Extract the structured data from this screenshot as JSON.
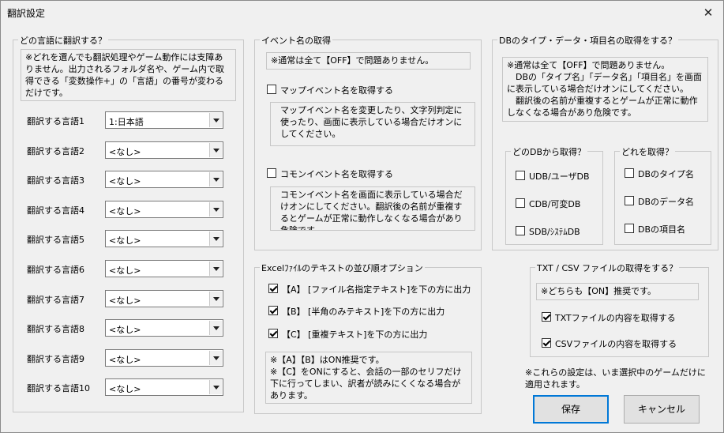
{
  "window": {
    "title": "翻訳設定",
    "close": "✕"
  },
  "lang_group": {
    "title": "どの言語に翻訳する？",
    "note": "※どれを選んでも翻訳処理やゲーム動作には支障ありません。出力されるフォルダ名や、ゲーム内で取得できる「変数操作+」の「言語」の番号が変わるだけです。",
    "rows": [
      {
        "label": "翻訳する言語1",
        "value": "1:日本語"
      },
      {
        "label": "翻訳する言語2",
        "value": "<なし>"
      },
      {
        "label": "翻訳する言語3",
        "value": "<なし>"
      },
      {
        "label": "翻訳する言語4",
        "value": "<なし>"
      },
      {
        "label": "翻訳する言語5",
        "value": "<なし>"
      },
      {
        "label": "翻訳する言語6",
        "value": "<なし>"
      },
      {
        "label": "翻訳する言語7",
        "value": "<なし>"
      },
      {
        "label": "翻訳する言語8",
        "value": "<なし>"
      },
      {
        "label": "翻訳する言語9",
        "value": "<なし>"
      },
      {
        "label": "翻訳する言語10",
        "value": "<なし>"
      }
    ]
  },
  "event_group": {
    "title": "イベント名の取得",
    "note": "※通常は全て【OFF】で問題ありません。",
    "map": {
      "label": "マップイベント名を取得する",
      "checked": false,
      "note": "マップイベント名を変更したり、文字列判定に使ったり、画面に表示している場合だけオンにしてください。"
    },
    "common": {
      "label": "コモンイベント名を取得する",
      "checked": false,
      "note": "コモンイベント名を画面に表示している場合だけオンにしてください。翻訳後の名前が重複するとゲームが正常に動作しなくなる場合があり危険です。"
    }
  },
  "db_group": {
    "title": "DBのタイプ・データ・項目名の取得をする？",
    "note": "※通常は全て【OFF】で問題ありません。\n　DBの「タイプ名」「データ名」「項目名」を画面に表示している場合だけオンにしてください。\n　翻訳後の名前が重複するとゲームが正常に動作しなくなる場合があり危険です。",
    "source": {
      "title": "どのDBから取得？",
      "items": [
        {
          "label": "UDB/ユーザDB",
          "checked": false
        },
        {
          "label": "CDB/可変DB",
          "checked": false
        },
        {
          "label": "SDB/ｼｽﾃﾑDB",
          "checked": false
        }
      ]
    },
    "which": {
      "title": "どれを取得？",
      "items": [
        {
          "label": "DBのタイプ名",
          "checked": false
        },
        {
          "label": "DBのデータ名",
          "checked": false
        },
        {
          "label": "DBの項目名",
          "checked": false
        }
      ]
    }
  },
  "excel_group": {
    "title": "Excelﾌｧｲﾙのテキストの並び順オプション",
    "items": [
      {
        "label": "【A】 [ファイル名指定テキスト]を下の方に出力",
        "checked": true
      },
      {
        "label": "【B】 [半角のみテキスト]を下の方に出力",
        "checked": true
      },
      {
        "label": "【C】 [重複テキスト]を下の方に出力",
        "checked": true
      }
    ],
    "note": "※【A】【B】はON推奨です。\n※【C】をONにすると、会話の一部のセリフだけ下に行ってしまい、訳者が読みにくくなる場合があります。"
  },
  "txt_group": {
    "title": "TXT / CSV ファイルの取得をする？",
    "note": "※どちらも【ON】推奨です。",
    "items": [
      {
        "label": "TXTファイルの内容を取得する",
        "checked": true
      },
      {
        "label": "CSVファイルの内容を取得する",
        "checked": true
      }
    ]
  },
  "footnote": "※これらの設定は、いま選択中のゲームだけに適用されます。",
  "buttons": {
    "save": "保存",
    "cancel": "キャンセル"
  }
}
